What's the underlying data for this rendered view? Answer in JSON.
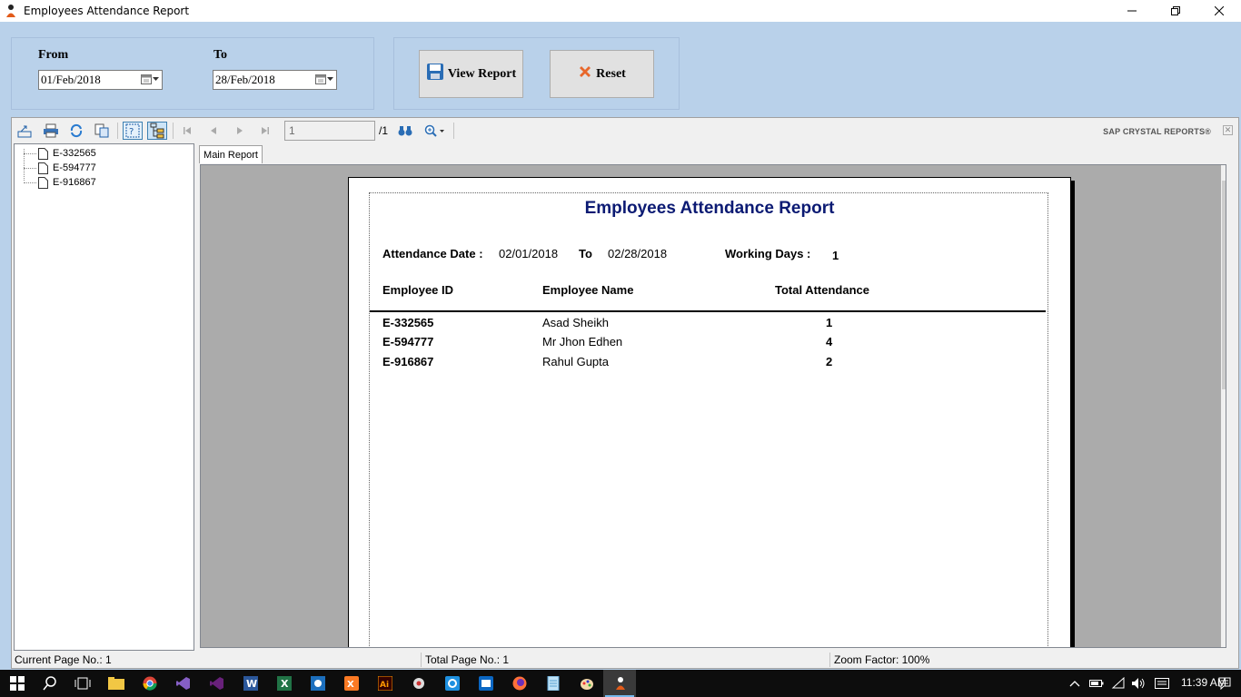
{
  "window": {
    "title": "Employees Attendance Report"
  },
  "filters": {
    "from_label": "From",
    "from_value": "01/Feb/2018",
    "to_label": "To",
    "to_value": "28/Feb/2018"
  },
  "actions": {
    "view_report": "View Report",
    "reset": "Reset"
  },
  "viewer": {
    "page_input": "1",
    "page_total": "/1",
    "brand": "SAP CRYSTAL REPORTS®",
    "tab": "Main Report",
    "tree_items": [
      "E-332565",
      "E-594777",
      "E-916867"
    ]
  },
  "report": {
    "title": "Employees Attendance Report",
    "attendance_date_label": "Attendance Date :",
    "date_from": "02/01/2018",
    "to_label": "To",
    "date_to": "02/28/2018",
    "working_days_label": "Working Days :",
    "working_days": "1",
    "columns": [
      "Employee ID",
      "Employee Name",
      "Total Attendance"
    ],
    "rows": [
      {
        "id": "E-332565",
        "name": "Asad Sheikh",
        "total": "1"
      },
      {
        "id": "E-594777",
        "name": "Mr Jhon Edhen",
        "total": "4"
      },
      {
        "id": "E-916867",
        "name": "Rahul Gupta",
        "total": "2"
      }
    ]
  },
  "status": {
    "current_page": "Current Page No.: 1",
    "total_page": "Total Page No.: 1",
    "zoom": "Zoom Factor: 100%"
  },
  "taskbar": {
    "clock": "11:39 AM"
  },
  "colors": {
    "window_bg": "#b9d1ea",
    "report_title": "#0b1a73",
    "taskbar": "#0d0d0d"
  }
}
